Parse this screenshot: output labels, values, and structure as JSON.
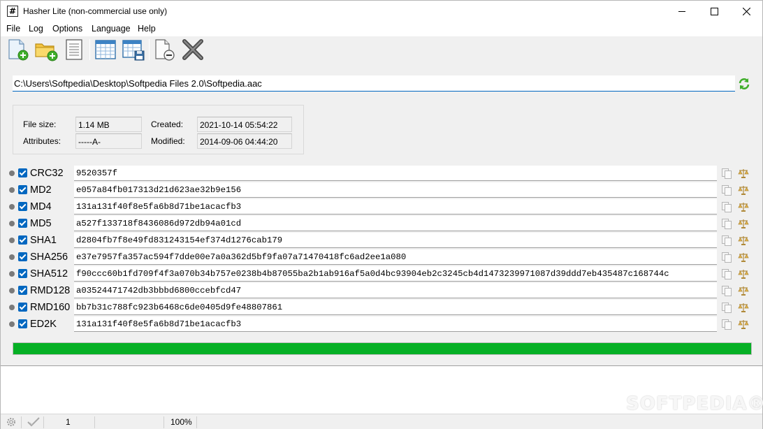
{
  "window": {
    "title": "Hasher Lite (non-commercial use only)",
    "app_icon": "#"
  },
  "menu": [
    "File",
    "Log",
    "Options",
    "Language",
    "Help"
  ],
  "toolbar": {
    "icons": [
      "add-file-icon",
      "add-folder-icon",
      "document-icon",
      "table-icon",
      "save-table-icon",
      "remove-file-icon",
      "close-x-icon"
    ]
  },
  "path": {
    "value": "C:\\Users\\Softpedia\\Desktop\\Softpedia Files 2.0\\Softpedia.aac"
  },
  "file_info": {
    "file_size_label": "File size:",
    "file_size": "1.14 MB",
    "attributes_label": "Attributes:",
    "attributes": "-----A-",
    "created_label": "Created:",
    "created": "2021-10-14 05:54:22",
    "modified_label": "Modified:",
    "modified": "2014-09-06 04:44:20"
  },
  "hashes": [
    {
      "name": "CRC32",
      "value": "9520357f"
    },
    {
      "name": "MD2",
      "value": "e057a84fb017313d21d623ae32b9e156"
    },
    {
      "name": "MD4",
      "value": "131a131f40f8e5fa6b8d71be1acacfb3"
    },
    {
      "name": "MD5",
      "value": "a527f133718f8436086d972db94a01cd"
    },
    {
      "name": "SHA1",
      "value": "d2804fb7f8e49fd831243154ef374d1276cab179"
    },
    {
      "name": "SHA256",
      "value": "e37e7957fa357ac594f7dde00e7a0a362d5bf9fa07a71470418fc6ad2ee1a080"
    },
    {
      "name": "SHA512",
      "value": "f90ccc60b1fd709f4f3a070b34b757e0238b4b87055ba2b1ab916af5a0d4bc93904eb2c3245cb4d1473239971087d39ddd7eb435487c168744c"
    },
    {
      "name": "RMD128",
      "value": "a03524471742db3bbbd6800ccebfcd47"
    },
    {
      "name": "RMD160",
      "value": "bb7b31c788fc923b6468c6de0405d9fe48807861"
    },
    {
      "name": "ED2K",
      "value": "131a131f40f8e5fa6b8d71be1acacfb3"
    }
  ],
  "progress": {
    "fraction": 1.0,
    "color": "#06b025"
  },
  "statusbar": {
    "count": "1",
    "percent": "100%"
  },
  "watermark": "SOFTPEDIA®",
  "colors": {
    "accent": "#0067c0",
    "progress": "#06b025"
  }
}
